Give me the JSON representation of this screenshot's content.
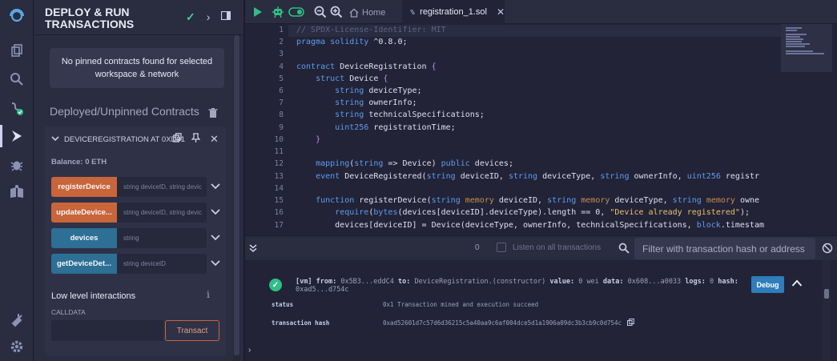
{
  "panel": {
    "title": "DEPLOY & RUN TRANSACTIONS",
    "pinned_message": "No pinned contracts found for selected workspace & network",
    "deployed_title": "Deployed/Unpinned Contracts",
    "instance": {
      "title": "DEVICEREGISTRATION AT 0XD91",
      "balance": "Balance: 0 ETH",
      "functions": [
        {
          "label": "registerDevice",
          "placeholder": "string deviceID, string devic",
          "color": "#c9653a"
        },
        {
          "label": "updateDevice...",
          "placeholder": "string deviceID, string devic",
          "color": "#c9653a"
        },
        {
          "label": "devices",
          "placeholder": "string",
          "color": "#2d6f95"
        },
        {
          "label": "getDeviceDet...",
          "placeholder": "string deviceID",
          "color": "#2d6f95"
        }
      ],
      "low_level_title": "Low level interactions",
      "calldata_label": "CALLDATA",
      "transact_label": "Transact"
    }
  },
  "tabs": {
    "home": "Home",
    "file": "registration_1.sol"
  },
  "editor": {
    "line_numbers": [
      "1",
      "2",
      "3",
      "4",
      "5",
      "6",
      "7",
      "8",
      "9",
      "10",
      "11",
      "12",
      "13",
      "14",
      "15",
      "16",
      "17"
    ]
  },
  "terminal_bar": {
    "count": "0",
    "listen_label": "Listen on all transactions",
    "filter_placeholder": "Filter with transaction hash or address"
  },
  "transaction": {
    "tag": "[vm]",
    "from_label": "from:",
    "from": "0x5B3...eddC4",
    "to_label": "to:",
    "to": "DeviceRegistration.(constructor)",
    "value_label": "value:",
    "value": "0 wei",
    "data_label": "data:",
    "data": "0x608...a0033",
    "logs_label": "logs:",
    "logs": "0",
    "hash_label": "hash:",
    "hash": "0xad5...d754c",
    "debug_label": "Debug",
    "status_key": "status",
    "status_value": "0x1 Transaction mined and execution succeed",
    "txhash_key": "transaction hash",
    "txhash_value": "0xad52601d7c57d6d36215c5a40aa9c6af004dce5d1a1906a09dc3b3cb9c0d754c"
  },
  "colors": {
    "accent_orange": "#c9653a",
    "accent_blue": "#2d6f95",
    "success": "#2fbf85",
    "keyword": "#5e9cf0"
  }
}
